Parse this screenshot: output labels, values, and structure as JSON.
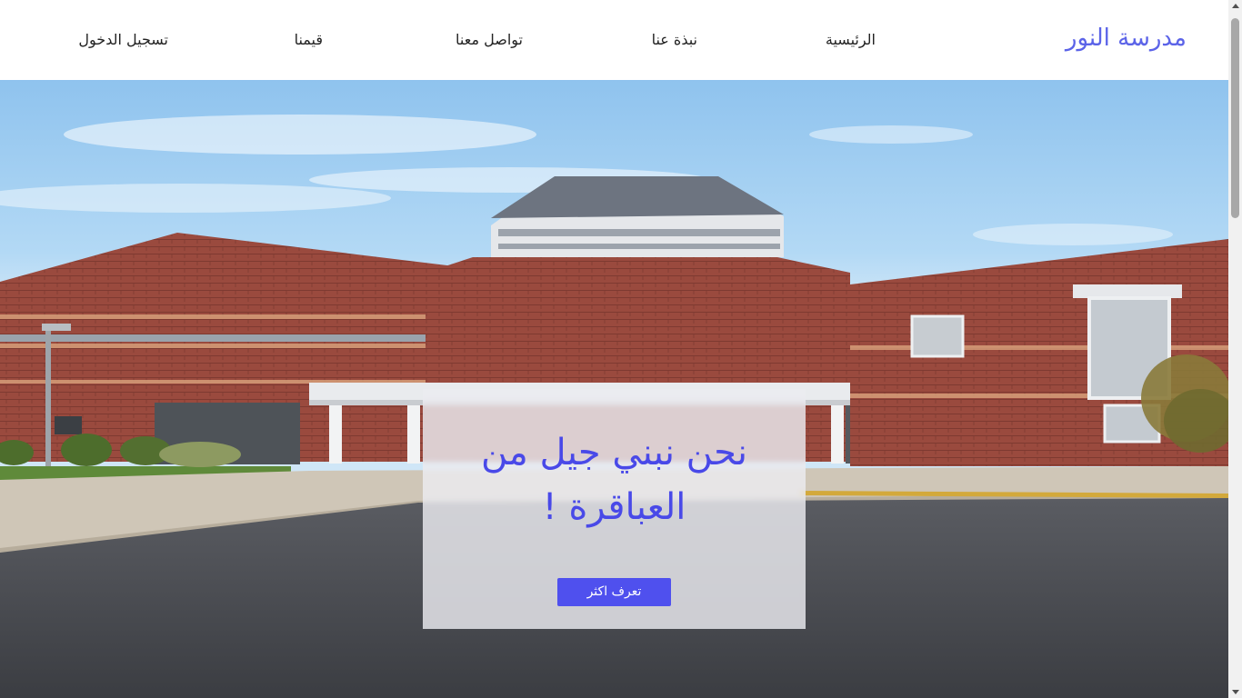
{
  "navbar": {
    "brand": "مدرسة النور",
    "links": {
      "home": "الرئيسية",
      "about": "نبذة عنا",
      "contact": "تواصل معنا",
      "values": "قيمنا",
      "login": "تسجيل الدخول"
    }
  },
  "hero": {
    "title": "نحن نبني جيل من العباقرة !",
    "button_label": "تعرف اكثر"
  },
  "colors": {
    "brand": "#5b63e8",
    "accent": "#4f50ee"
  }
}
